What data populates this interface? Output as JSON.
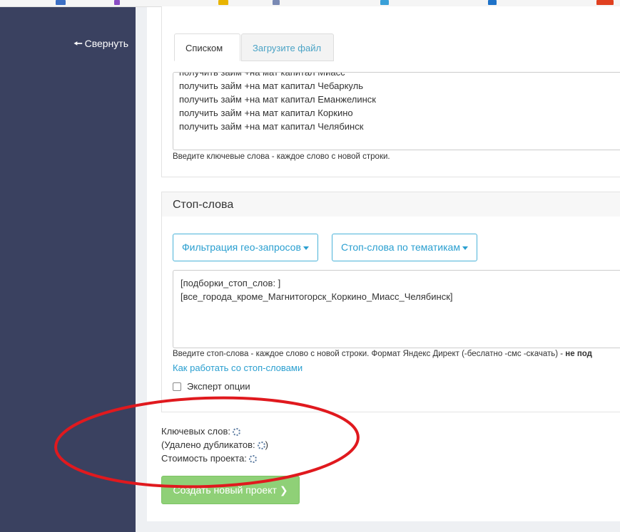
{
  "sidebar": {
    "collapse_label": "Свернуть"
  },
  "tabs": [
    {
      "label": "Списком",
      "active": true
    },
    {
      "label": "Загрузите файл",
      "active": false
    }
  ],
  "keywords": {
    "lines": [
      "получить займ +на мат капитал Чебаркуль",
      "получить займ +на мат капитал Еманжелинск",
      "получить займ +на мат капитал Коркино",
      "получить займ +на мат капитал Челябинск"
    ],
    "help": "Введите ключевые слова - каждое слово с новой строки."
  },
  "stopwords": {
    "title": "Стоп-слова",
    "geo_filter_button": "Фильтрация гео-запросов",
    "topic_button": "Стоп-слова по тематикам",
    "lines": [
      "[подборки_стоп_слов: ]",
      "[все_города_кроме_Магнитогорск_Коркино_Миасс_Челябинск]"
    ],
    "help_text": "Введите стоп-слова - каждое слово с новой строки. Формат Яндекс Директ (-беслатно -смс -скачать) -",
    "help_bold": "не под",
    "how_to_link": "Как работать со стоп-словами",
    "expert_label": "Эксперт опции",
    "expert_checked": false
  },
  "stats": {
    "keywords_label": "Ключевых слов:",
    "duplicates_label": "(Удалено дубликатов:",
    "duplicates_close": ")",
    "cost_label": "Стоимость проекта:"
  },
  "create_button": {
    "label": "Создать новый проект",
    "icon": "chevron-right-icon"
  },
  "colors": {
    "sidebar": "#3a4160",
    "accent": "#2a9fd0",
    "create_button": "#8fd077",
    "annotation": "#e0191e"
  }
}
